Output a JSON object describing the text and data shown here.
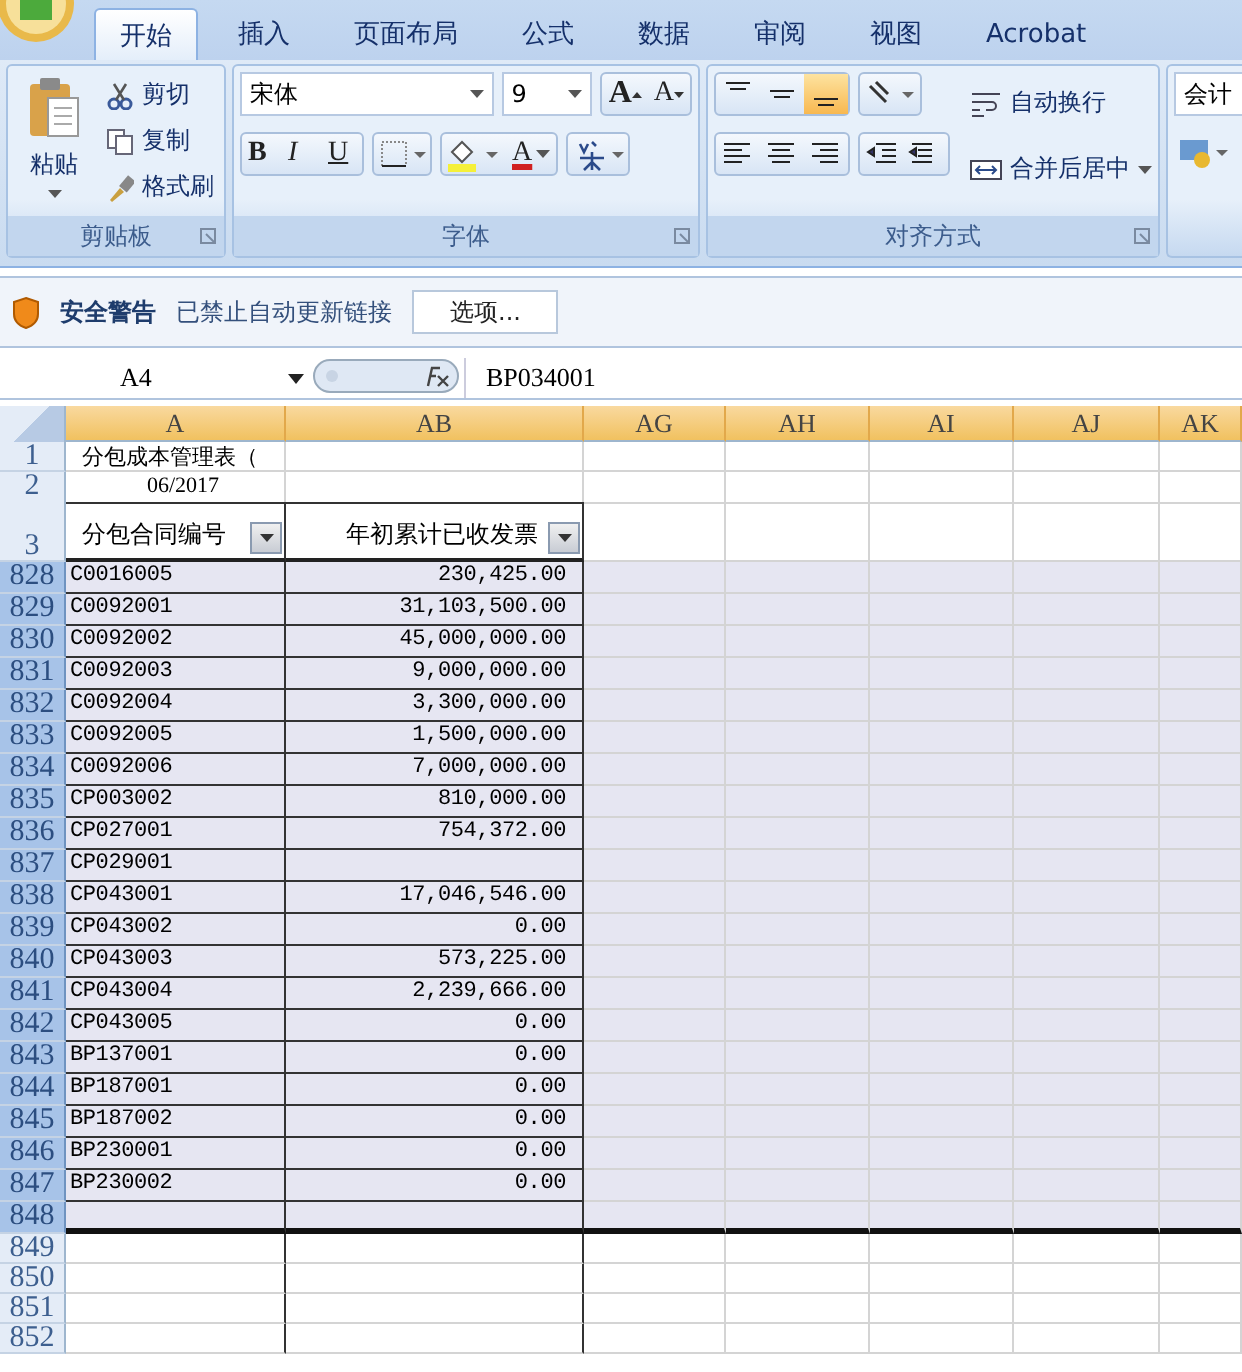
{
  "tabs": [
    {
      "label": "开始",
      "selected": true
    },
    {
      "label": "插入",
      "selected": false
    },
    {
      "label": "页面布局",
      "selected": false
    },
    {
      "label": "公式",
      "selected": false
    },
    {
      "label": "数据",
      "selected": false
    },
    {
      "label": "审阅",
      "selected": false
    },
    {
      "label": "视图",
      "selected": false
    },
    {
      "label": "Acrobat",
      "selected": false
    }
  ],
  "clipboard": {
    "paste": "粘贴",
    "cut": "剪切",
    "copy": "复制",
    "format_painter": "格式刷",
    "label": "剪贴板"
  },
  "font": {
    "name": "宋体",
    "size": "9",
    "label": "字体",
    "grow": "A",
    "shrink": "A",
    "bold": "B",
    "italic": "I",
    "underline": "U",
    "font_color": "A"
  },
  "alignment": {
    "vertical": [
      {
        "kind": "top",
        "selected": false
      },
      {
        "kind": "middle",
        "selected": false
      },
      {
        "kind": "bottom",
        "selected": true
      }
    ],
    "wrap": "自动换行",
    "merge": "合并后居中",
    "label": "对齐方式"
  },
  "number": {
    "format": "会计"
  },
  "security": {
    "title": "安全警告",
    "message": "已禁止自动更新链接",
    "button": "选项..."
  },
  "formula_bar": {
    "name_box": "A4",
    "formula": "BP034001"
  },
  "sheet": {
    "columns": [
      {
        "label": "A",
        "selected": true
      },
      {
        "label": "AB",
        "selected": true
      },
      {
        "label": "AG",
        "selected": true
      },
      {
        "label": "AH",
        "selected": true
      },
      {
        "label": "AI",
        "selected": true
      },
      {
        "label": "AJ",
        "selected": true
      },
      {
        "label": "AK",
        "selected": true
      }
    ],
    "rows": [
      {
        "number": "1",
        "kind": "title",
        "selected": false,
        "cells": [
          "分包成本管理表（"
        ]
      },
      {
        "number": "2",
        "kind": "date",
        "selected": false,
        "cells": [
          "06/2017"
        ]
      },
      {
        "number": "3",
        "kind": "header",
        "selected": false,
        "cells": [
          "分包合同编号",
          "年初累计已收发票"
        ]
      },
      {
        "number": "828",
        "kind": "data",
        "selected": true,
        "cells": [
          "C0016005",
          "230,425.00"
        ]
      },
      {
        "number": "829",
        "kind": "data",
        "selected": true,
        "cells": [
          "C0092001",
          "31,103,500.00"
        ]
      },
      {
        "number": "830",
        "kind": "data",
        "selected": true,
        "cells": [
          "C0092002",
          "45,000,000.00"
        ]
      },
      {
        "number": "831",
        "kind": "data",
        "selected": true,
        "cells": [
          "C0092003",
          "9,000,000.00"
        ]
      },
      {
        "number": "832",
        "kind": "data",
        "selected": true,
        "cells": [
          "C0092004",
          "3,300,000.00"
        ]
      },
      {
        "number": "833",
        "kind": "data",
        "selected": true,
        "cells": [
          "C0092005",
          "1,500,000.00"
        ]
      },
      {
        "number": "834",
        "kind": "data",
        "selected": true,
        "cells": [
          "C0092006",
          "7,000,000.00"
        ]
      },
      {
        "number": "835",
        "kind": "data",
        "selected": true,
        "cells": [
          "CP003002",
          "810,000.00"
        ]
      },
      {
        "number": "836",
        "kind": "data",
        "selected": true,
        "cells": [
          "CP027001",
          "754,372.00"
        ]
      },
      {
        "number": "837",
        "kind": "data",
        "selected": true,
        "cells": [
          "CP029001"
        ]
      },
      {
        "number": "838",
        "kind": "data",
        "selected": true,
        "cells": [
          "CP043001",
          "17,046,546.00"
        ]
      },
      {
        "number": "839",
        "kind": "data",
        "selected": true,
        "cells": [
          "CP043002",
          "0.00"
        ]
      },
      {
        "number": "840",
        "kind": "data",
        "selected": true,
        "cells": [
          "CP043003",
          "573,225.00"
        ]
      },
      {
        "number": "841",
        "kind": "data",
        "selected": true,
        "cells": [
          "CP043004",
          "2,239,666.00"
        ]
      },
      {
        "number": "842",
        "kind": "data",
        "selected": true,
        "cells": [
          "CP043005",
          "0.00"
        ]
      },
      {
        "number": "843",
        "kind": "data",
        "selected": true,
        "cells": [
          "BP137001",
          "0.00"
        ]
      },
      {
        "number": "844",
        "kind": "data",
        "selected": true,
        "cells": [
          "BP187001",
          "0.00"
        ]
      },
      {
        "number": "845",
        "kind": "data",
        "selected": true,
        "cells": [
          "BP187002",
          "0.00"
        ]
      },
      {
        "number": "846",
        "kind": "data",
        "selected": true,
        "cells": [
          "BP230001",
          "0.00"
        ]
      },
      {
        "number": "847",
        "kind": "data",
        "selected": true,
        "cells": [
          "BP230002",
          "0.00"
        ]
      },
      {
        "number": "848",
        "kind": "empty",
        "selected": true,
        "cells": []
      },
      {
        "number": "849",
        "kind": "empty",
        "selected": false,
        "cells": []
      },
      {
        "number": "850",
        "kind": "empty",
        "selected": false,
        "cells": []
      },
      {
        "number": "851",
        "kind": "empty",
        "selected": false,
        "cells": []
      },
      {
        "number": "852",
        "kind": "empty",
        "selected": false,
        "cells": []
      }
    ]
  }
}
